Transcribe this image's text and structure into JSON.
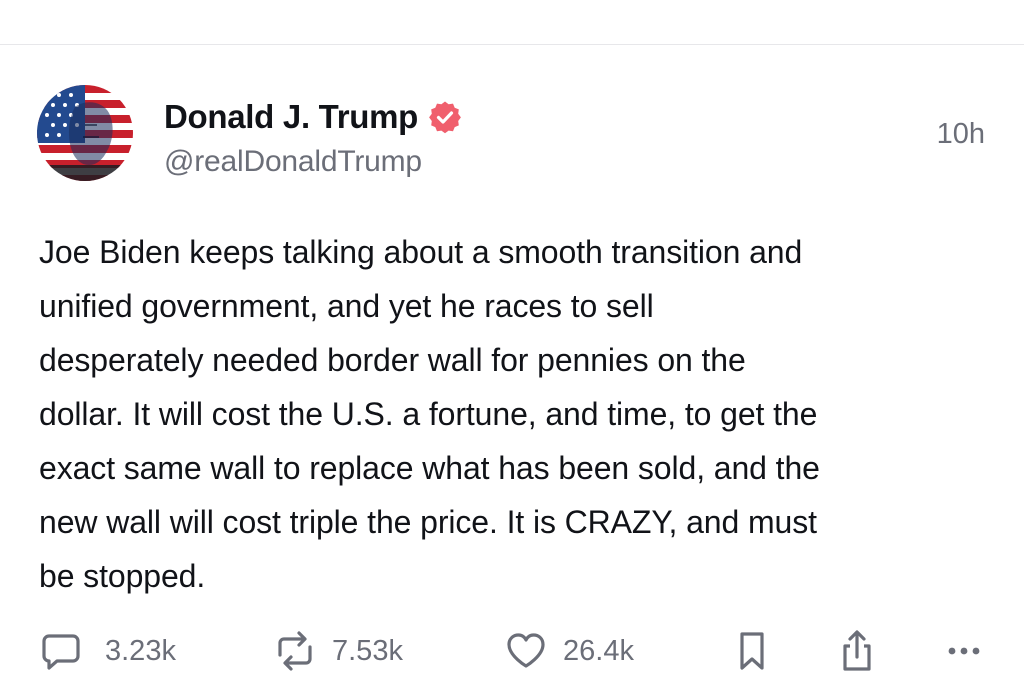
{
  "post": {
    "display_name": "Donald J. Trump",
    "handle": "@realDonaldTrump",
    "timestamp": "10h",
    "verified_icon": "verified-badge-icon",
    "body": "Joe Biden keeps talking about a smooth transition and\nunified government, and yet he races to sell\ndesperately needed border wall for pennies on the\ndollar. It will cost the U.S. a fortune, and time, to get the\nexact same wall to replace what has been sold, and the\nnew wall will cost triple the price. It is CRAZY, and must\nbe stopped.",
    "colors": {
      "verified_badge": "#f05f6d",
      "muted_text": "#6b6e78",
      "primary_text": "#111318"
    }
  },
  "actions": {
    "replies": {
      "icon": "comment-icon",
      "count": "3.23k"
    },
    "retruths": {
      "icon": "repost-icon",
      "count": "7.53k"
    },
    "likes": {
      "icon": "heart-icon",
      "count": "26.4k"
    },
    "bookmark": {
      "icon": "bookmark-icon"
    },
    "share": {
      "icon": "share-icon"
    },
    "more": {
      "icon": "more-icon"
    }
  }
}
